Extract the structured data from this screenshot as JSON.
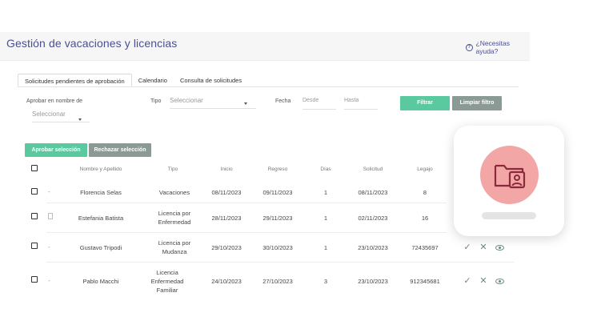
{
  "app": {
    "title": "Gestión de vacaciones y licencias",
    "help_label": "¿Necesitas ayuda?",
    "help_icon": "?"
  },
  "tabs": [
    {
      "label": "Solicitudes pendientes de aprobación",
      "active": true
    },
    {
      "label": "Calendario",
      "active": false
    },
    {
      "label": "Consulta de solicitudes",
      "active": false
    }
  ],
  "filters": {
    "on_behalf_label": "Aprobar en nombre de",
    "on_behalf_placeholder": "Seleccionar",
    "type_label": "Tipo",
    "type_placeholder": "Seleccionar",
    "date_label": "Fecha",
    "date_from_placeholder": "Desde",
    "date_to_placeholder": "Hasta",
    "filter_button": "Filtrar",
    "clear_button": "Limpiar filtro"
  },
  "bulk_actions": {
    "approve_button": "Aprobar selección",
    "reject_button": "Rechazar selección"
  },
  "table": {
    "headers": [
      "Nombre y Apellido",
      "Tipo",
      "Inicio",
      "Regreso",
      "Días",
      "Solicitud",
      "Legajo"
    ],
    "rows": [
      {
        "attachment": "-",
        "name": "Florencia Selas",
        "type_lines": [
          "Vacaciones"
        ],
        "start": "08/11/2023",
        "return": "09/11/2023",
        "days": "1",
        "requested": "08/11/2023",
        "file": "8",
        "actions": false
      },
      {
        "attachment": "icon",
        "name": "Estefania Batista",
        "type_lines": [
          "Licencia por",
          "Enfermedad"
        ],
        "start": "28/11/2023",
        "return": "29/11/2023",
        "days": "1",
        "requested": "02/11/2023",
        "file": "16",
        "actions": false
      },
      {
        "attachment": "-",
        "name": "Gustavo Tripodi",
        "type_lines": [
          "Licencia por",
          "Mudanza"
        ],
        "start": "29/10/2023",
        "return": "30/10/2023",
        "days": "1",
        "requested": "23/10/2023",
        "file": "72435697",
        "actions": true
      },
      {
        "attachment": "-",
        "name": "Pablo Macchi",
        "type_lines": [
          "Licencia",
          "Enfermedad",
          "Familiar"
        ],
        "start": "24/10/2023",
        "return": "27/10/2023",
        "days": "3",
        "requested": "23/10/2023",
        "file": "912345681",
        "actions": true
      }
    ]
  },
  "row_actions": {
    "approve_glyph": "✓",
    "reject_glyph": "✕",
    "view_icon": "eye-icon"
  },
  "card": {
    "icon": "folder-user-icon"
  },
  "colors": {
    "title": "#4b4f8f",
    "primary_button": "#5bc9a0",
    "secondary_button": "#8c9a96",
    "avatar_circle": "#f2a6a6",
    "avatar_icon": "#8a2a3a",
    "action_icons": "#6c8a80"
  }
}
